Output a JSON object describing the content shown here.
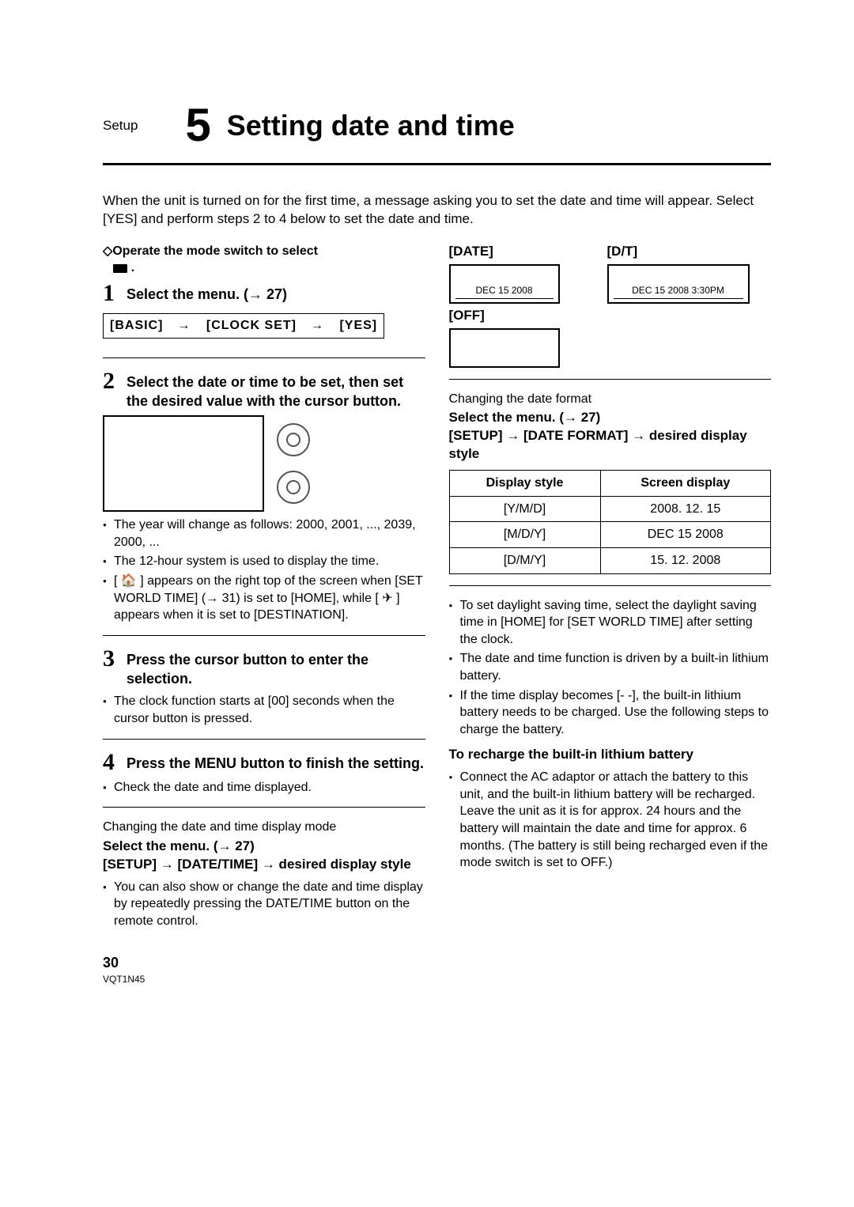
{
  "header": {
    "category": "Setup",
    "chapter_number": "5",
    "title": "Setting date and time"
  },
  "intro": "When the unit is turned on for the first time, a message asking you to set the date and time will appear. Select [YES] and perform steps 2 to 4 below to set the date and time.",
  "left": {
    "operate_line": "Operate the mode switch to select",
    "step1": "Select the menu. (→ 27)",
    "menu1": {
      "a": "[BASIC]",
      "b": "[CLOCK SET]",
      "c": "[YES]"
    },
    "step2": "Select the date or time to be set, then set the desired value with the cursor button.",
    "bullets_a": [
      "The year will change as follows: 2000, 2001, ..., 2039, 2000, ...",
      "The 12-hour system is used to display the time.",
      "[ 🏠 ] appears on the right top of the screen when [SET WORLD TIME] (→ 31) is set to [HOME], while [ ✈ ] appears when it is set to [DESTINATION]."
    ],
    "step3": "Press the cursor button to enter the selection.",
    "bullets_b": [
      "The clock function starts at [00] seconds when the cursor button is pressed."
    ],
    "step4": "Press the MENU button to finish the setting.",
    "bullets_c": [
      "Check the date and time displayed."
    ],
    "changing_mode_title": "Changing the date and time display mode",
    "select_menu": "Select the menu. (→ 27)",
    "menu2_line": "[SETUP] → [DATE/TIME] → desired display style",
    "bullets_d": [
      "You can also show or change the date and time display by repeatedly pressing the DATE/TIME button on the remote control."
    ]
  },
  "right": {
    "disp": {
      "date_label": "[DATE]",
      "dt_label": "[D/T]",
      "off_label": "[OFF]",
      "date_value": "DEC 15 2008",
      "dt_value": "DEC 15 2008  3:30PM",
      "off_value": ""
    },
    "changing_format_title": "Changing the date format",
    "select_menu": "Select the menu. (→ 27)",
    "menu3_line": "[SETUP] → [DATE FORMAT] → desired display style",
    "table": {
      "h1": "Display style",
      "h2": "Screen display",
      "rows": [
        {
          "style": "[Y/M/D]",
          "disp": "2008. 12. 15"
        },
        {
          "style": "[M/D/Y]",
          "disp": "DEC 15 2008"
        },
        {
          "style": "[D/M/Y]",
          "disp": "15. 12. 2008"
        }
      ]
    },
    "bullets_e": [
      "To set daylight saving time, select the daylight saving time in [HOME] for [SET WORLD TIME] after setting the clock.",
      "The date and time function is driven by a built-in lithium battery.",
      "If the time display becomes [- -], the built-in lithium battery needs to be charged. Use the following steps to charge the battery."
    ],
    "recharge_title": "To recharge the built-in lithium battery",
    "bullets_f": [
      "Connect the AC adaptor or attach the battery to this unit, and the built-in lithium battery will be recharged. Leave the unit as it is for approx. 24 hours and the battery will maintain the date and time for approx. 6 months. (The battery is still being recharged even if the mode switch is set to OFF.)"
    ]
  },
  "footer": {
    "page": "30",
    "code": "VQT1N45"
  }
}
